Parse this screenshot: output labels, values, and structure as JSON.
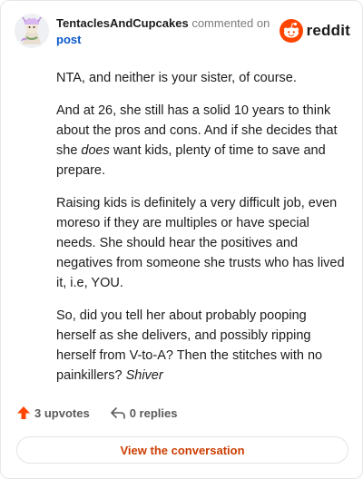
{
  "comment": {
    "username": "TentaclesAndCupcakes",
    "action_text": "commented on",
    "target_link": "post"
  },
  "brand": {
    "name": "reddit",
    "accent_color": "#ff4500",
    "logo_icon": "reddit-alien-icon"
  },
  "body": {
    "p1": "NTA, and neither is your sister, of course.",
    "p2": "And at 26, she still has a solid 10 years to think about the pros and cons. And if she decides that she ",
    "p2_em": "does",
    "p2_end": " want kids, plenty of time to save and prepare.",
    "p3": "Raising kids is definitely a very difficult job, even moreso if they are multiples or have special needs. She should hear the positives and negatives from someone she trusts who has lived it, i.e, YOU.",
    "p4": "So, did you tell her about probably pooping herself as she delivers, and possibly ripping herself from V-to-A? Then the stitches with no painkillers? ",
    "p4_em": "Shiver"
  },
  "footer": {
    "upvotes": "3 upvotes",
    "upvote_icon": "upvote-arrow-icon",
    "replies": "0 replies",
    "reply_icon": "reply-arrow-icon"
  },
  "cta": {
    "view_label": "View the conversation"
  }
}
